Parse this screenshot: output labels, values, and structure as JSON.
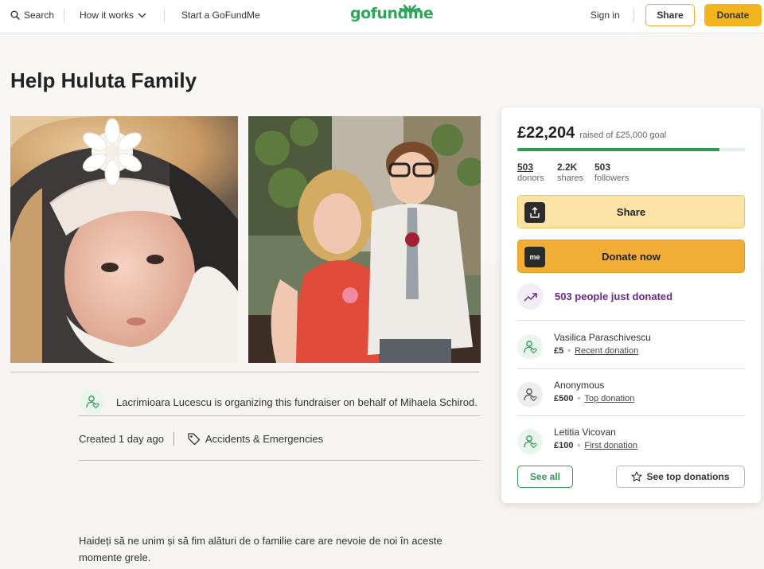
{
  "header": {
    "search_label": "Search",
    "how_it_works_label": "How it works",
    "start_label": "Start a GoFundMe",
    "logo_text": "gofundme",
    "sign_in_label": "Sign in",
    "share_label": "Share",
    "donate_label": "Donate"
  },
  "campaign": {
    "title": "Help Huluta Family",
    "organizer_text": "Lacrimioara Lucescu is organizing this fundraiser on behalf of Mihaela Schirod.",
    "created": "Created 1 day ago",
    "category": "Accidents & Emergencies",
    "story": "Haideți să ne unim și să fim alături de o familie care are nevoie de noi în aceste momente grele."
  },
  "donation_card": {
    "raised_amount": "£22,204",
    "goal_text": "raised of £25,000 goal",
    "progress_percent": 88.8,
    "stats": [
      {
        "value": "503",
        "label": "donors"
      },
      {
        "value": "2.2K",
        "label": "shares"
      },
      {
        "value": "503",
        "label": "followers"
      }
    ],
    "share_button": "Share",
    "donate_button": "Donate now",
    "donate_icon_text": "me",
    "just_donated": "503 people just donated",
    "donations": [
      {
        "name": "Vasilica Paraschivescu",
        "amount": "£5",
        "tag": "Recent donation"
      },
      {
        "name": "Anonymous",
        "amount": "£500",
        "tag": "Top donation"
      },
      {
        "name": "Letitia Vicovan",
        "amount": "£100",
        "tag": "First donation"
      }
    ],
    "see_all_label": "See all",
    "see_top_label": "See top donations"
  },
  "colors": {
    "brand_green": "#2ea55a",
    "donate_orange": "#f2ad35",
    "accent_purple": "#6a2a8a"
  },
  "icons": [
    "search-icon",
    "chevron-down-icon",
    "gofundme-leaves-icon",
    "share-upload-icon",
    "gofundme-me-icon",
    "trending-up-icon",
    "donor-heart-icon",
    "tag-icon",
    "star-icon"
  ]
}
